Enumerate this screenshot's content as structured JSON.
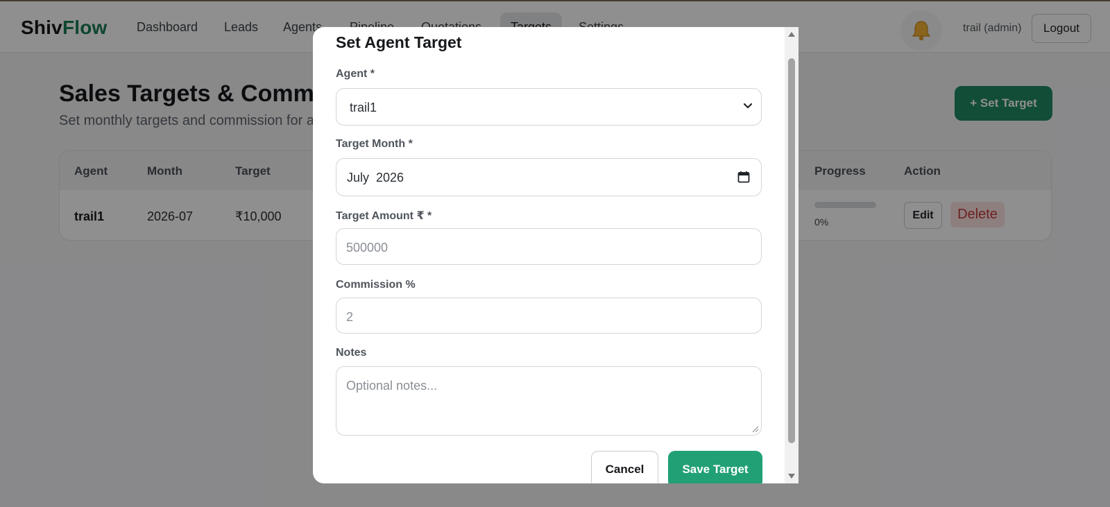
{
  "navbar": {
    "brand_prefix": "Shiv",
    "brand_accent": "Flow",
    "links": [
      "Dashboard",
      "Leads",
      "Agents",
      "Pipeline",
      "Quotations",
      "Targets",
      "Settings"
    ],
    "active_link": "Targets",
    "bell_icon": "bell-icon",
    "user_label": "trail (admin)",
    "logout_label": "Logout"
  },
  "page": {
    "title": "Sales Targets & Commission",
    "subtitle": "Set monthly targets and commission for agents",
    "set_target_label": "+ Set Target"
  },
  "table": {
    "columns": [
      "Agent",
      "Month",
      "Target",
      "Progress",
      "Action"
    ],
    "rows": [
      {
        "agent": "trail1",
        "month": "2026-07",
        "target": "₹10,000",
        "progress_text": "0%",
        "progress_fraction": 0,
        "edit_label": "Edit",
        "delete_label": "Delete"
      }
    ]
  },
  "modal": {
    "title": "Set Agent Target",
    "agent_label": "Agent *",
    "agent_value": "trail1",
    "month_label": "Target Month *",
    "month_value": "July  2026",
    "amount_label": "Target Amount ₹ *",
    "amount_placeholder": "500000",
    "commission_label": "Commission %",
    "commission_placeholder": "2",
    "notes_label": "Notes",
    "notes_placeholder": "Optional notes...",
    "cancel_label": "Cancel",
    "save_label": "Save Target"
  },
  "colors": {
    "brand_green": "#1a7d55",
    "primary_button": "#1f8a62",
    "save_button": "#21a075",
    "delete_text": "#c43a3a",
    "delete_bg": "#fde2e2",
    "overlay": "rgba(0,0,0,0.44)"
  }
}
